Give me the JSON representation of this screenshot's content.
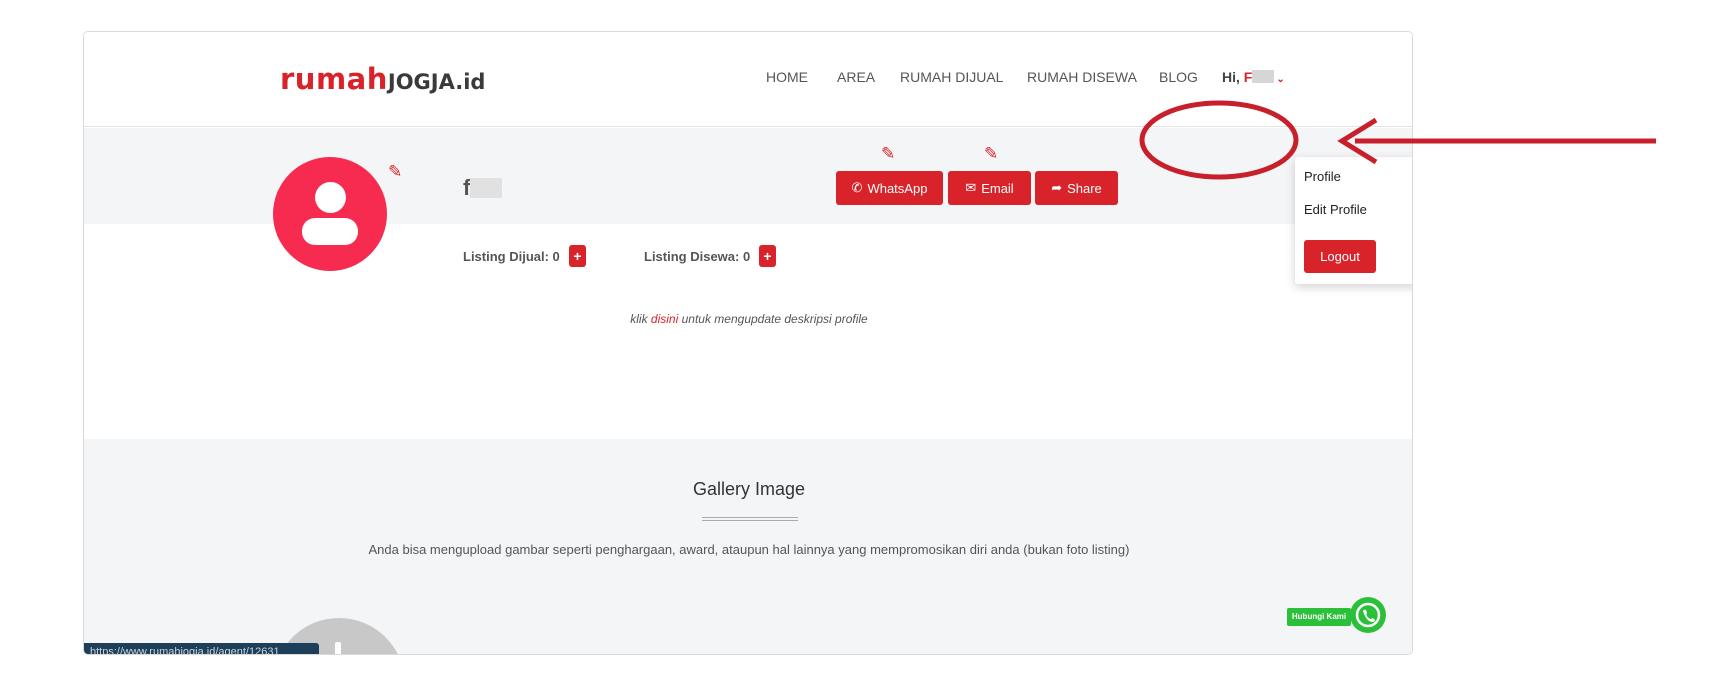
{
  "logo": {
    "part1": "rumah",
    "part2": "JOGJA",
    "part3": ".id"
  },
  "nav": {
    "items": [
      "HOME",
      "AREA",
      "RUMAH DIJUAL",
      "RUMAH DISEWA",
      "BLOG"
    ],
    "greeting": "Hi,",
    "user_initial": "F"
  },
  "profile": {
    "name_initial": "f",
    "listing_dijual": "Listing Dijual: 0",
    "listing_disewa": "Listing Disewa: 0",
    "plus_label": "+",
    "desc_prefix": "klik ",
    "desc_link": "disini",
    "desc_suffix": " untuk mengupdate deskripsi profile"
  },
  "buttons": {
    "whatsapp": "WhatsApp",
    "email": "Email",
    "share": "Share"
  },
  "dropdown": {
    "profile": "Profile",
    "edit_profile": "Edit Profile",
    "logout": "Logout"
  },
  "gallery": {
    "title": "Gallery Image",
    "text": "Anda bisa mengupload gambar seperti penghargaan, award, ataupun hal lainnya yang mempromosikan diri anda (bukan foto listing)"
  },
  "status_bar": {
    "url": "https://www.rumahjogja.id/agent/12631"
  },
  "whatsapp_widget": {
    "label": "Hubungi Kami"
  },
  "colors": {
    "brand_red": "#d8232a",
    "avatar_pink": "#f72a50",
    "whatsapp_green": "#2bbf3a",
    "band_grey": "#f4f5f7"
  },
  "icons": [
    "pencil-icon",
    "whatsapp-icon",
    "envelope-icon",
    "share-icon",
    "user-icon",
    "chevron-down-icon"
  ]
}
